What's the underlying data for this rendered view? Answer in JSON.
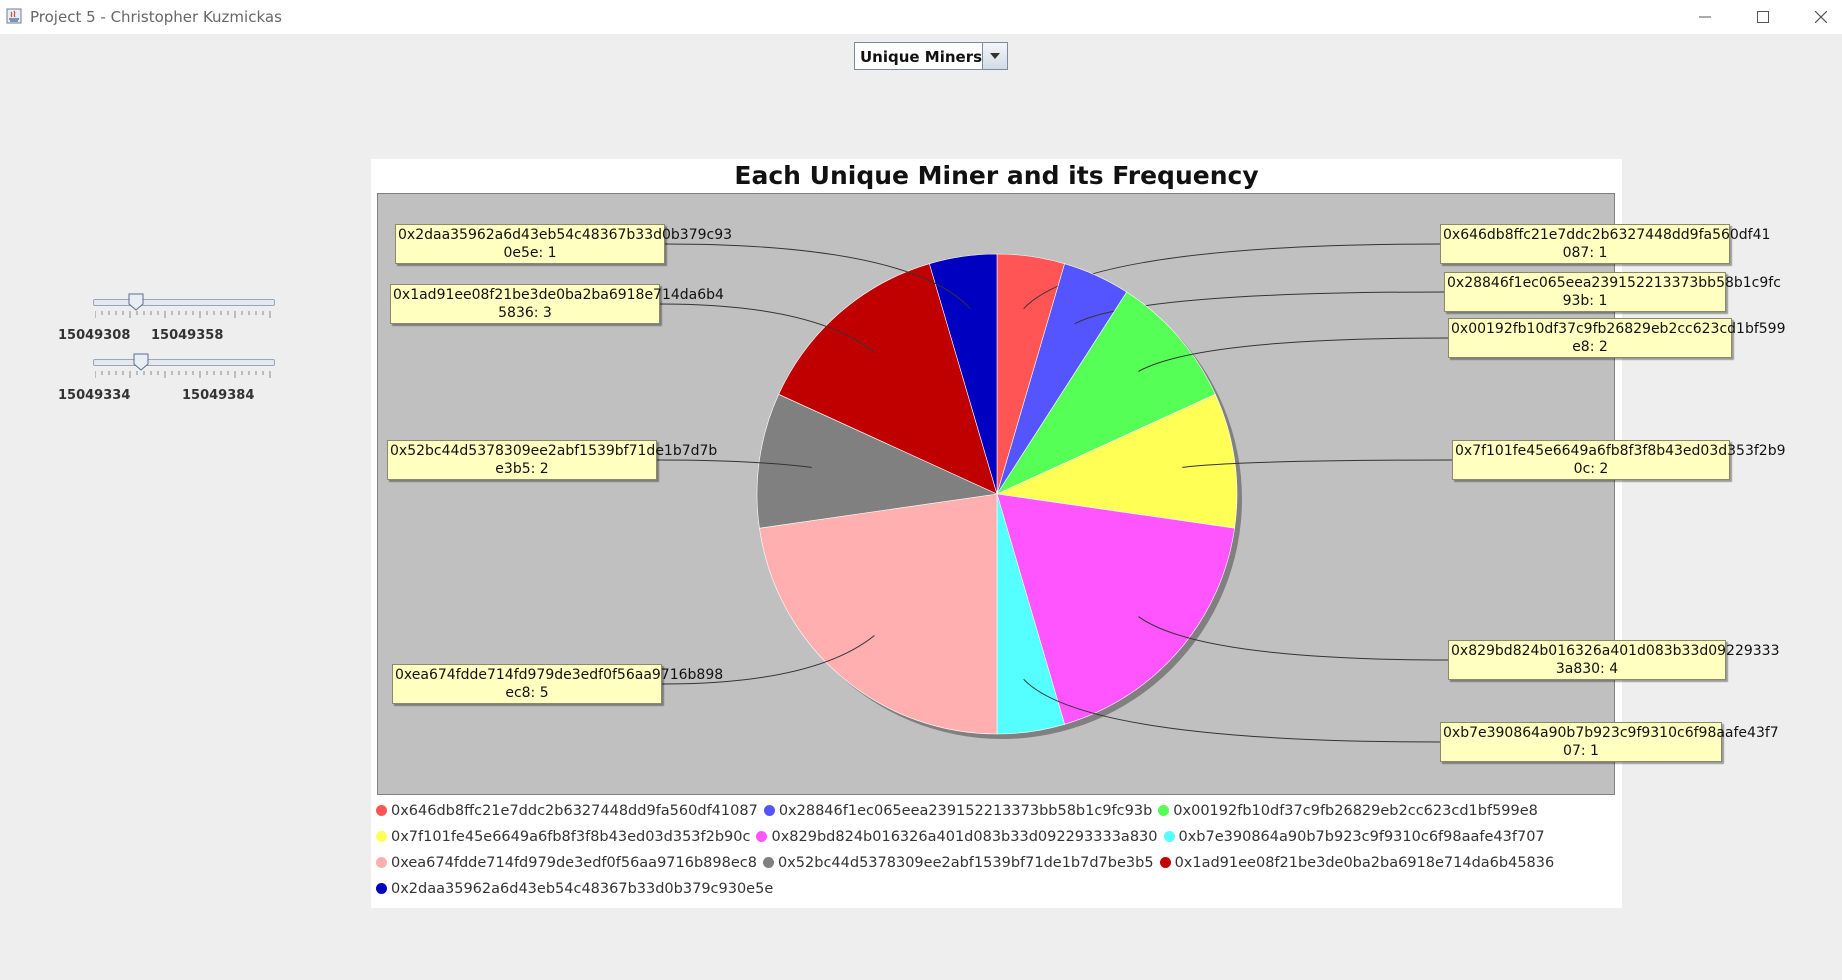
{
  "window": {
    "title": "Project 5 - Christopher Kuzmickas"
  },
  "combo": {
    "selected": "Unique Miners"
  },
  "sliders": [
    {
      "min_label": "15049308",
      "max_label": "15049358"
    },
    {
      "min_label": "15049334",
      "max_label": "15049384"
    }
  ],
  "chart_data": {
    "type": "pie",
    "title": "Each Unique Miner and its Frequency",
    "legend_position": "bottom",
    "slices": [
      {
        "name": "0x646db8ffc21e7ddc2b6327448dd9fa560df41087",
        "value": 1,
        "color": "#ff5555",
        "callout": "0x646db8ffc21e7ddc2b6327448dd9fa560df41\n087: 1"
      },
      {
        "name": "0x28846f1ec065eea239152213373bb58b1c9fc93b",
        "value": 1,
        "color": "#5555ff",
        "callout": "0x28846f1ec065eea239152213373bb58b1c9fc\n93b: 1"
      },
      {
        "name": "0x00192fb10df37c9fb26829eb2cc623cd1bf599e8",
        "value": 2,
        "color": "#55ff55",
        "callout": "0x00192fb10df37c9fb26829eb2cc623cd1bf599\ne8: 2"
      },
      {
        "name": "0x7f101fe45e6649a6fb8f3f8b43ed03d353f2b90c",
        "value": 2,
        "color": "#ffff55",
        "callout": "0x7f101fe45e6649a6fb8f3f8b43ed03d353f2b9\n0c: 2"
      },
      {
        "name": "0x829bd824b016326a401d083b33d092293333a830",
        "value": 4,
        "color": "#ff55ff",
        "callout": "0x829bd824b016326a401d083b33d09229333\n3a830: 4"
      },
      {
        "name": "0xb7e390864a90b7b923c9f9310c6f98aafe43f707",
        "value": 1,
        "color": "#55ffff",
        "callout": "0xb7e390864a90b7b923c9f9310c6f98aafe43f7\n07: 1"
      },
      {
        "name": "0xea674fdde714fd979de3edf0f56aa9716b898ec8",
        "value": 5,
        "color": "#ffafaf",
        "callout": "0xea674fdde714fd979de3edf0f56aa9716b898\nec8: 5"
      },
      {
        "name": "0x52bc44d5378309ee2abf1539bf71de1b7d7be3b5",
        "value": 2,
        "color": "#808080",
        "callout": "0x52bc44d5378309ee2abf1539bf71de1b7d7b\ne3b5: 2"
      },
      {
        "name": "0x1ad91ee08f21be3de0ba2ba6918e714da6b45836",
        "value": 3,
        "color": "#c00000",
        "callout": "0x1ad91ee08f21be3de0ba2ba6918e714da6b4\n5836: 3"
      },
      {
        "name": "0x2daa35962a6d43eb54c48367b33d0b379c930e5e",
        "value": 1,
        "color": "#0000c0",
        "callout": "0x2daa35962a6d43eb54c48367b33d0b379c93\n0e5e: 1"
      }
    ]
  }
}
